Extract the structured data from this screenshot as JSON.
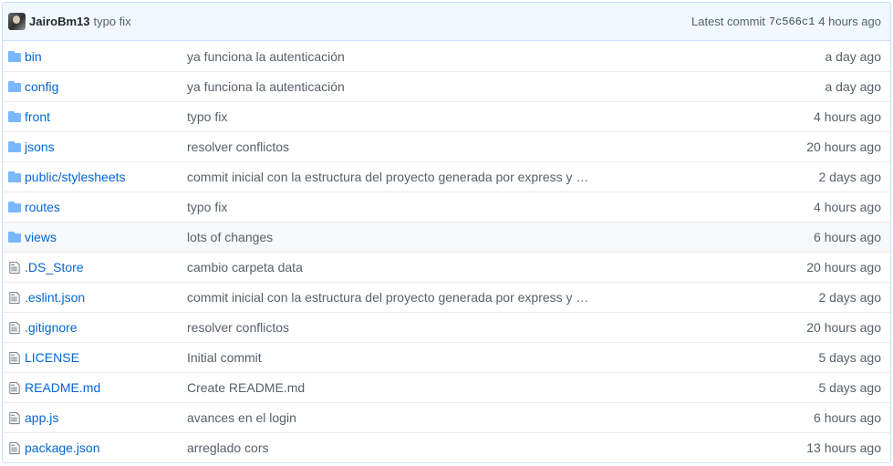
{
  "commit_bar": {
    "author": "JairoBm13",
    "message": "typo fix",
    "latest_label": "Latest commit",
    "sha": "7c566c1",
    "age": "4 hours ago"
  },
  "colors": {
    "link": "#0366d6",
    "muted": "#586069",
    "icon": "#79b8ff",
    "file_icon": "#6a737d"
  },
  "files": [
    {
      "type": "dir-icon",
      "name": "bin",
      "message": "ya funciona la autenticación",
      "age": "a day ago"
    },
    {
      "type": "dir-icon",
      "name": "config",
      "message": "ya funciona la autenticación",
      "age": "a day ago"
    },
    {
      "type": "dir-icon",
      "name": "front",
      "message": "typo fix",
      "age": "4 hours ago"
    },
    {
      "type": "dir-icon",
      "name": "jsons",
      "message": "resolver conflictos",
      "age": "20 hours ago"
    },
    {
      "type": "dir-icon",
      "name": "public/stylesheets",
      "message": "commit inicial con la estructura del proyecto generada por express y …",
      "age": "2 days ago"
    },
    {
      "type": "dir-icon",
      "name": "routes",
      "message": "typo fix",
      "age": "4 hours ago"
    },
    {
      "type": "dir-icon",
      "name": "views",
      "message": "lots of changes",
      "age": "6 hours ago"
    },
    {
      "type": "file-icon",
      "name": ".DS_Store",
      "message": "cambio carpeta data",
      "age": "20 hours ago"
    },
    {
      "type": "file-icon",
      "name": ".eslint.json",
      "message": "commit inicial con la estructura del proyecto generada por express y …",
      "age": "2 days ago"
    },
    {
      "type": "file-icon",
      "name": ".gitignore",
      "message": "resolver conflictos",
      "age": "20 hours ago"
    },
    {
      "type": "file-icon",
      "name": "LICENSE",
      "message": "Initial commit",
      "age": "5 days ago"
    },
    {
      "type": "file-icon",
      "name": "README.md",
      "message": "Create README.md",
      "age": "5 days ago"
    },
    {
      "type": "file-icon",
      "name": "app.js",
      "message": "avances en el login",
      "age": "6 hours ago"
    },
    {
      "type": "file-icon",
      "name": "package.json",
      "message": "arreglado cors",
      "age": "13 hours ago"
    }
  ]
}
